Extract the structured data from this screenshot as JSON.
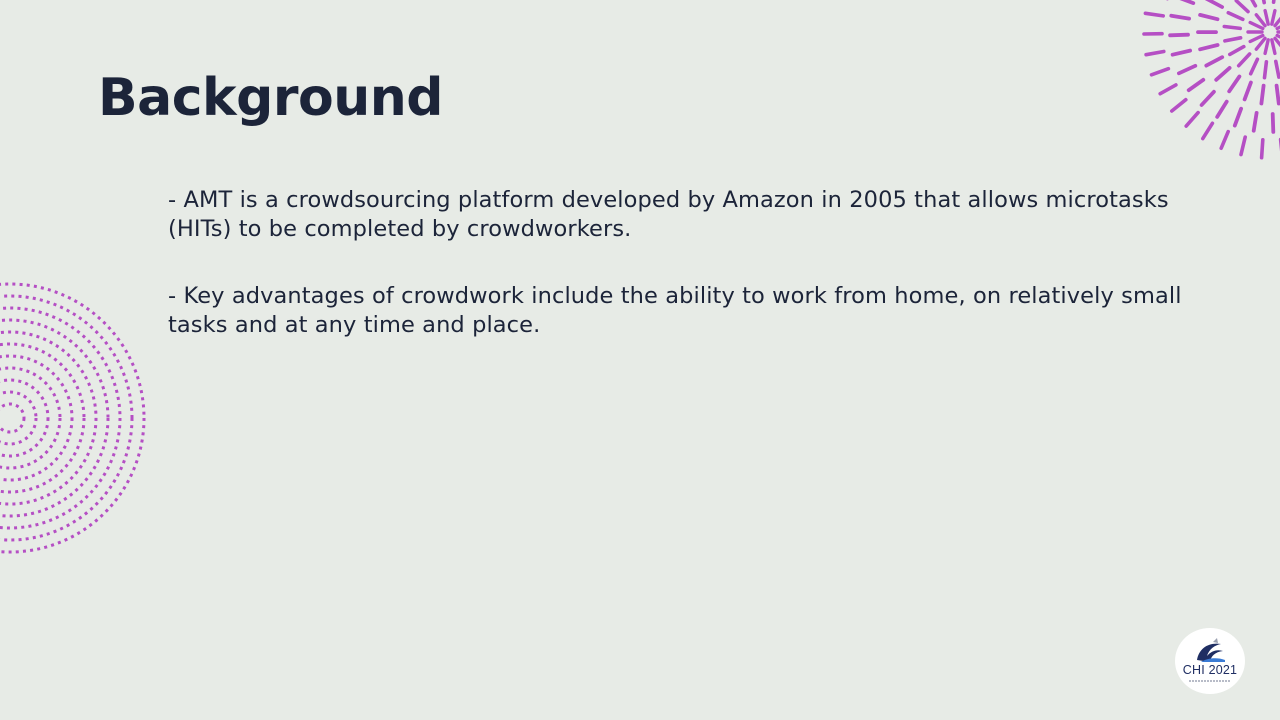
{
  "slide": {
    "title": "Background",
    "bullets": [
      "- AMT is a crowdsourcing platform developed by Amazon in 2005 that allows microtasks (HITs) to be completed by crowdworkers.",
      "- Key advantages of crowdwork include the ability to work from home, on relatively small tasks and at any time and place."
    ]
  },
  "logo": {
    "text": "CHI 2021",
    "icon": "chi-wave-logo-icon"
  },
  "decorations": {
    "top_right": "sunburst-dash-icon",
    "left": "concentric-dotted-circles-icon",
    "accent_color": "#b54fc4"
  },
  "colors": {
    "background": "#e7ebe6",
    "text": "#1c2439",
    "logo_text": "#1f2e63"
  }
}
